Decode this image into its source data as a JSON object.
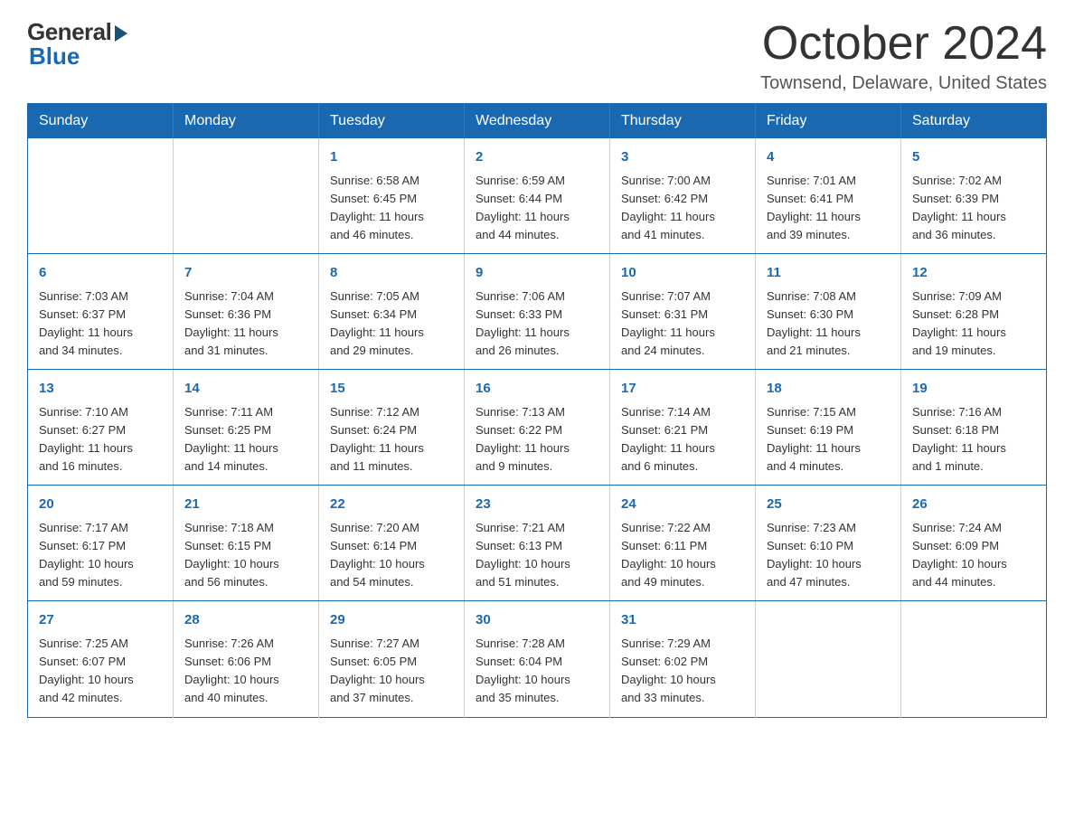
{
  "logo": {
    "general": "General",
    "blue": "Blue"
  },
  "header": {
    "month": "October 2024",
    "location": "Townsend, Delaware, United States"
  },
  "weekdays": [
    "Sunday",
    "Monday",
    "Tuesday",
    "Wednesday",
    "Thursday",
    "Friday",
    "Saturday"
  ],
  "weeks": [
    [
      {
        "day": "",
        "info": ""
      },
      {
        "day": "",
        "info": ""
      },
      {
        "day": "1",
        "info": "Sunrise: 6:58 AM\nSunset: 6:45 PM\nDaylight: 11 hours\nand 46 minutes."
      },
      {
        "day": "2",
        "info": "Sunrise: 6:59 AM\nSunset: 6:44 PM\nDaylight: 11 hours\nand 44 minutes."
      },
      {
        "day": "3",
        "info": "Sunrise: 7:00 AM\nSunset: 6:42 PM\nDaylight: 11 hours\nand 41 minutes."
      },
      {
        "day": "4",
        "info": "Sunrise: 7:01 AM\nSunset: 6:41 PM\nDaylight: 11 hours\nand 39 minutes."
      },
      {
        "day": "5",
        "info": "Sunrise: 7:02 AM\nSunset: 6:39 PM\nDaylight: 11 hours\nand 36 minutes."
      }
    ],
    [
      {
        "day": "6",
        "info": "Sunrise: 7:03 AM\nSunset: 6:37 PM\nDaylight: 11 hours\nand 34 minutes."
      },
      {
        "day": "7",
        "info": "Sunrise: 7:04 AM\nSunset: 6:36 PM\nDaylight: 11 hours\nand 31 minutes."
      },
      {
        "day": "8",
        "info": "Sunrise: 7:05 AM\nSunset: 6:34 PM\nDaylight: 11 hours\nand 29 minutes."
      },
      {
        "day": "9",
        "info": "Sunrise: 7:06 AM\nSunset: 6:33 PM\nDaylight: 11 hours\nand 26 minutes."
      },
      {
        "day": "10",
        "info": "Sunrise: 7:07 AM\nSunset: 6:31 PM\nDaylight: 11 hours\nand 24 minutes."
      },
      {
        "day": "11",
        "info": "Sunrise: 7:08 AM\nSunset: 6:30 PM\nDaylight: 11 hours\nand 21 minutes."
      },
      {
        "day": "12",
        "info": "Sunrise: 7:09 AM\nSunset: 6:28 PM\nDaylight: 11 hours\nand 19 minutes."
      }
    ],
    [
      {
        "day": "13",
        "info": "Sunrise: 7:10 AM\nSunset: 6:27 PM\nDaylight: 11 hours\nand 16 minutes."
      },
      {
        "day": "14",
        "info": "Sunrise: 7:11 AM\nSunset: 6:25 PM\nDaylight: 11 hours\nand 14 minutes."
      },
      {
        "day": "15",
        "info": "Sunrise: 7:12 AM\nSunset: 6:24 PM\nDaylight: 11 hours\nand 11 minutes."
      },
      {
        "day": "16",
        "info": "Sunrise: 7:13 AM\nSunset: 6:22 PM\nDaylight: 11 hours\nand 9 minutes."
      },
      {
        "day": "17",
        "info": "Sunrise: 7:14 AM\nSunset: 6:21 PM\nDaylight: 11 hours\nand 6 minutes."
      },
      {
        "day": "18",
        "info": "Sunrise: 7:15 AM\nSunset: 6:19 PM\nDaylight: 11 hours\nand 4 minutes."
      },
      {
        "day": "19",
        "info": "Sunrise: 7:16 AM\nSunset: 6:18 PM\nDaylight: 11 hours\nand 1 minute."
      }
    ],
    [
      {
        "day": "20",
        "info": "Sunrise: 7:17 AM\nSunset: 6:17 PM\nDaylight: 10 hours\nand 59 minutes."
      },
      {
        "day": "21",
        "info": "Sunrise: 7:18 AM\nSunset: 6:15 PM\nDaylight: 10 hours\nand 56 minutes."
      },
      {
        "day": "22",
        "info": "Sunrise: 7:20 AM\nSunset: 6:14 PM\nDaylight: 10 hours\nand 54 minutes."
      },
      {
        "day": "23",
        "info": "Sunrise: 7:21 AM\nSunset: 6:13 PM\nDaylight: 10 hours\nand 51 minutes."
      },
      {
        "day": "24",
        "info": "Sunrise: 7:22 AM\nSunset: 6:11 PM\nDaylight: 10 hours\nand 49 minutes."
      },
      {
        "day": "25",
        "info": "Sunrise: 7:23 AM\nSunset: 6:10 PM\nDaylight: 10 hours\nand 47 minutes."
      },
      {
        "day": "26",
        "info": "Sunrise: 7:24 AM\nSunset: 6:09 PM\nDaylight: 10 hours\nand 44 minutes."
      }
    ],
    [
      {
        "day": "27",
        "info": "Sunrise: 7:25 AM\nSunset: 6:07 PM\nDaylight: 10 hours\nand 42 minutes."
      },
      {
        "day": "28",
        "info": "Sunrise: 7:26 AM\nSunset: 6:06 PM\nDaylight: 10 hours\nand 40 minutes."
      },
      {
        "day": "29",
        "info": "Sunrise: 7:27 AM\nSunset: 6:05 PM\nDaylight: 10 hours\nand 37 minutes."
      },
      {
        "day": "30",
        "info": "Sunrise: 7:28 AM\nSunset: 6:04 PM\nDaylight: 10 hours\nand 35 minutes."
      },
      {
        "day": "31",
        "info": "Sunrise: 7:29 AM\nSunset: 6:02 PM\nDaylight: 10 hours\nand 33 minutes."
      },
      {
        "day": "",
        "info": ""
      },
      {
        "day": "",
        "info": ""
      }
    ]
  ]
}
